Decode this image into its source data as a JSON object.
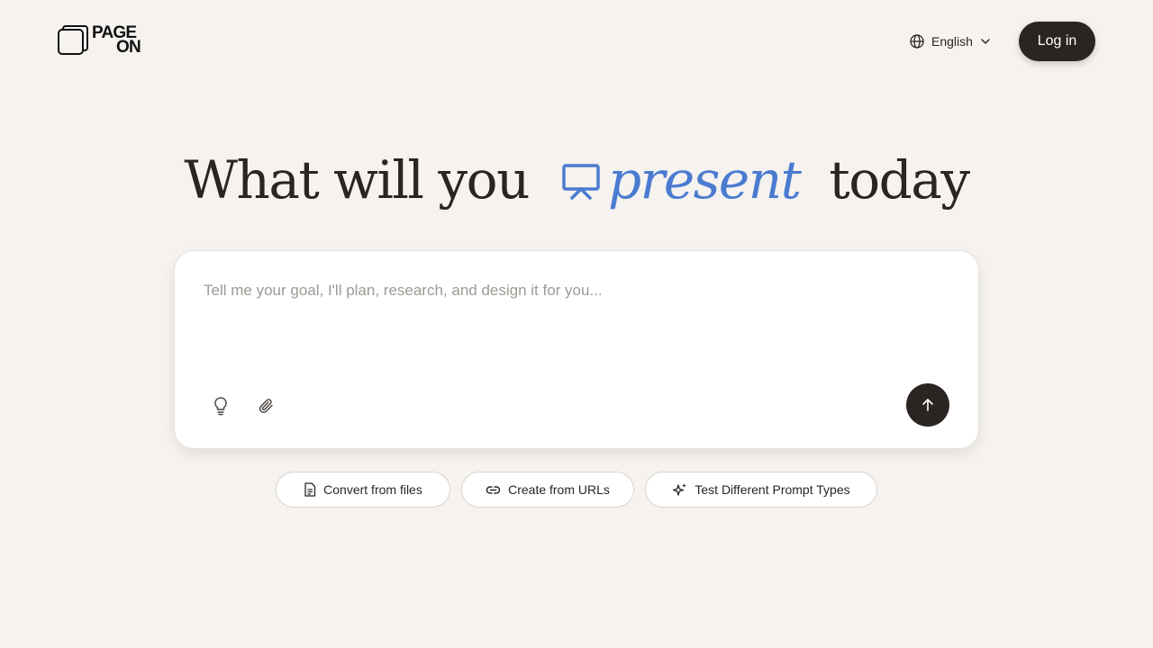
{
  "brand": {
    "logo_line1": "PAGE",
    "logo_line2": "ON"
  },
  "header": {
    "language_label": "English",
    "login_label": "Log in"
  },
  "hero": {
    "headline_start": "What will you",
    "headline_highlight": "present",
    "headline_end": "today",
    "highlight_color": "#4a7bd0"
  },
  "prompt": {
    "placeholder": "Tell me your goal, I'll plan, research, and design it for you...",
    "value": ""
  },
  "chips": [
    {
      "label": "Convert from files",
      "icon": "document-icon"
    },
    {
      "label": "Create from URLs",
      "icon": "link-icon"
    },
    {
      "label": "Test Different Prompt Types",
      "icon": "sparkle-icon"
    }
  ],
  "colors": {
    "background": "#f5f2ef",
    "dark": "#2a2522"
  }
}
